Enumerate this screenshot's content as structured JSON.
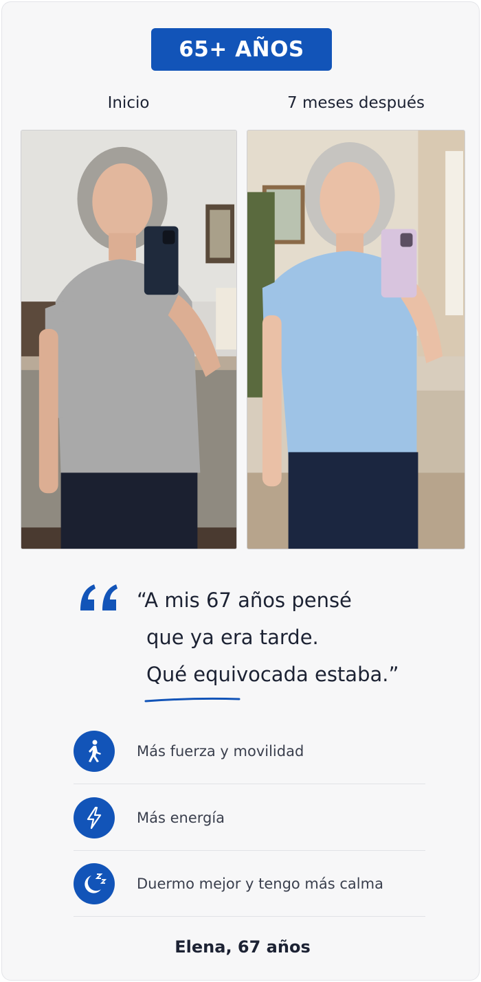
{
  "badge": {
    "label": "65+ AÑOS"
  },
  "columns": {
    "before_label": "Inicio",
    "after_label": "7 meses después"
  },
  "testimonial": {
    "line1": "“A mis 67 años pensé",
    "line2": "que ya era tarde.",
    "line3": "Qué equivocada estaba.”"
  },
  "benefits": [
    {
      "icon": "walking-person-icon",
      "label": "Más fuerza y movilidad"
    },
    {
      "icon": "lightning-bolt-icon",
      "label": "Más energía"
    },
    {
      "icon": "moon-sleep-icon",
      "label": "Duermo mejor y tengo más calma"
    }
  ],
  "author": "Elena, 67 años",
  "colors": {
    "accent": "#1254b8",
    "text": "#1c2233",
    "card_bg": "#f7f7f8"
  }
}
